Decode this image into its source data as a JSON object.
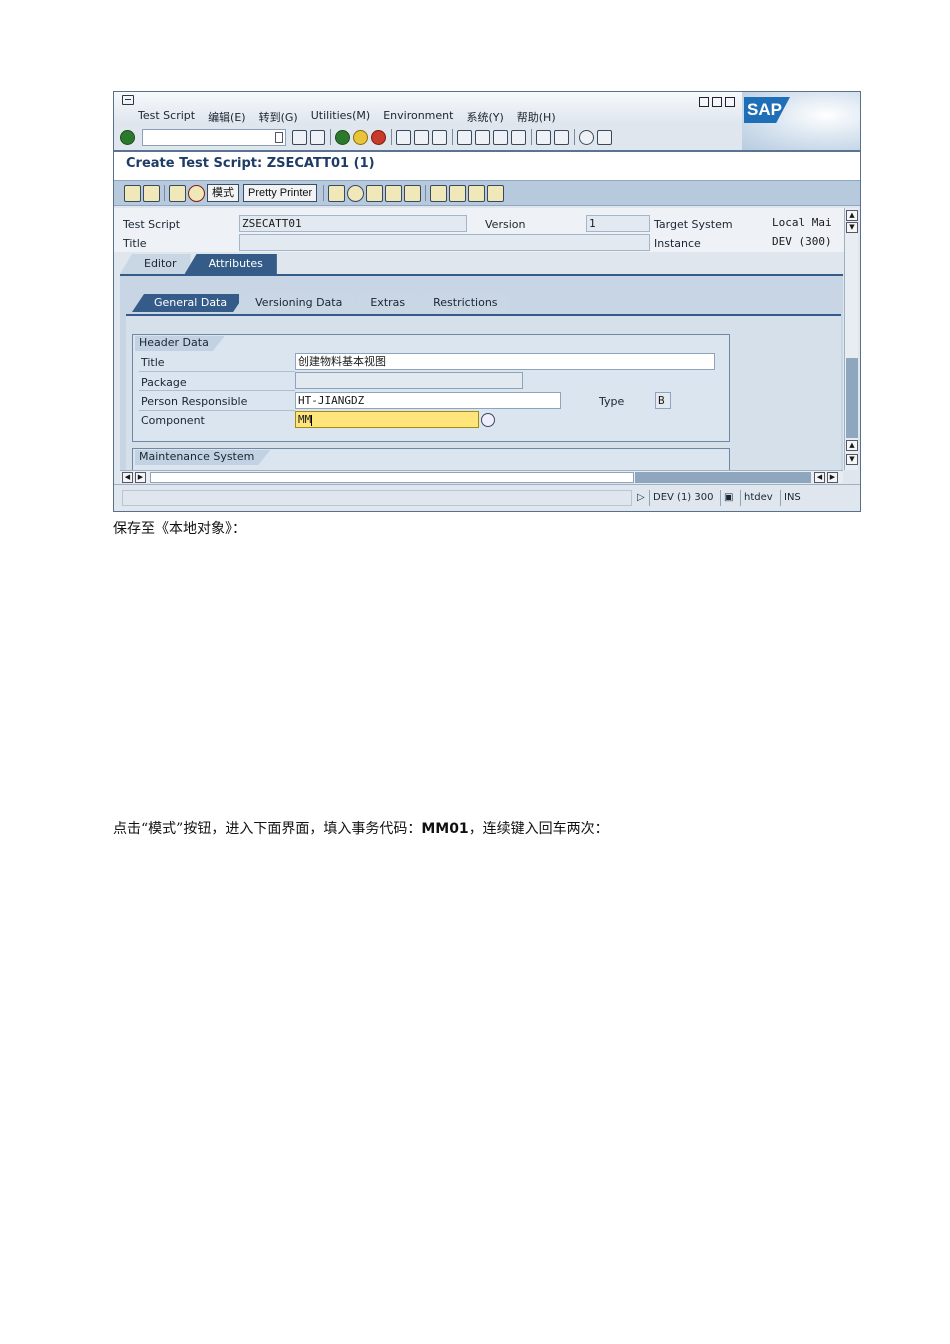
{
  "window": {
    "menu": [
      "Test Script",
      "编辑(E)",
      "转到(G)",
      "Utilities(M)",
      "Environment",
      "系统(Y)",
      "帮助(H)"
    ],
    "logo": "SAP",
    "title": "Create Test Script: ZSECATT01 (1)"
  },
  "app_toolbar": {
    "mode_button": "模式",
    "pretty_printer_button": "Pretty Printer"
  },
  "header": {
    "test_script_label": "Test Script",
    "test_script_value": "ZSECATT01",
    "version_label": "Version",
    "version_value": "1",
    "target_system_label": "Target System",
    "target_system_value": "Local Mai",
    "title_label": "Title",
    "title_value": "",
    "instance_label": "Instance",
    "instance_value": "DEV (300)"
  },
  "tabs_outer": [
    "Editor",
    "Attributes"
  ],
  "tabs_inner": [
    "General Data",
    "Versioning Data",
    "Extras",
    "Restrictions"
  ],
  "header_data": {
    "group_title": "Header Data",
    "title_label": "Title",
    "title_value": "创建物料基本视图",
    "package_label": "Package",
    "package_value": "",
    "person_label": "Person Responsible",
    "person_value": "HT-JIANGDZ",
    "type_label": "Type",
    "type_value": "B",
    "component_label": "Component",
    "component_value": "MM"
  },
  "maintenance": {
    "group_title": "Maintenance System"
  },
  "statusbar": {
    "system": "DEV (1) 300",
    "server": "htdev",
    "mode": "INS"
  },
  "doc": {
    "line1": "保存至《本地对象》：",
    "line2_prefix": "点击“模式”按钮，进入下面界面，填入事务代码：",
    "line2_code": "MM01",
    "line2_suffix": "，连续键入回车两次："
  }
}
